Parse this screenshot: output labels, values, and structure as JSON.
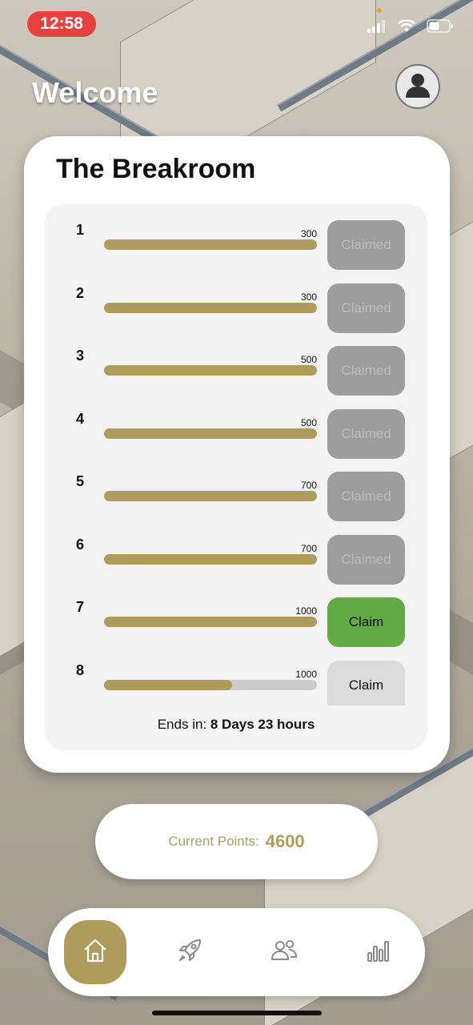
{
  "status_bar": {
    "time": "12:58"
  },
  "header": {
    "welcome": "Welcome"
  },
  "card": {
    "title": "The Breakroom",
    "rows": [
      {
        "num": "1",
        "target": "300",
        "progress": 1.0,
        "button": "Claimed",
        "state": "claimed"
      },
      {
        "num": "2",
        "target": "300",
        "progress": 1.0,
        "button": "Claimed",
        "state": "claimed"
      },
      {
        "num": "3",
        "target": "500",
        "progress": 1.0,
        "button": "Claimed",
        "state": "claimed"
      },
      {
        "num": "4",
        "target": "500",
        "progress": 1.0,
        "button": "Claimed",
        "state": "claimed"
      },
      {
        "num": "5",
        "target": "700",
        "progress": 1.0,
        "button": "Claimed",
        "state": "claimed"
      },
      {
        "num": "6",
        "target": "700",
        "progress": 1.0,
        "button": "Claimed",
        "state": "claimed"
      },
      {
        "num": "7",
        "target": "1000",
        "progress": 1.0,
        "button": "Claim",
        "state": "ready"
      },
      {
        "num": "8",
        "target": "1000",
        "progress": 0.6,
        "button": "Claim",
        "state": "disabled"
      }
    ],
    "ends_in_label": "Ends in:",
    "ends_in_value": "8 Days 23 hours"
  },
  "points": {
    "label": "Current Points:",
    "value": "4600"
  },
  "nav": {
    "items": [
      {
        "icon": "home-icon",
        "active": true
      },
      {
        "icon": "rocket-icon",
        "active": false
      },
      {
        "icon": "users-icon",
        "active": false
      },
      {
        "icon": "bar-chart-icon",
        "active": false
      }
    ]
  },
  "colors": {
    "accent": "#ae9c5c",
    "claim_ready": "#62ab44",
    "claimed": "#9d9d9d",
    "time_pill": "#e8403f"
  }
}
